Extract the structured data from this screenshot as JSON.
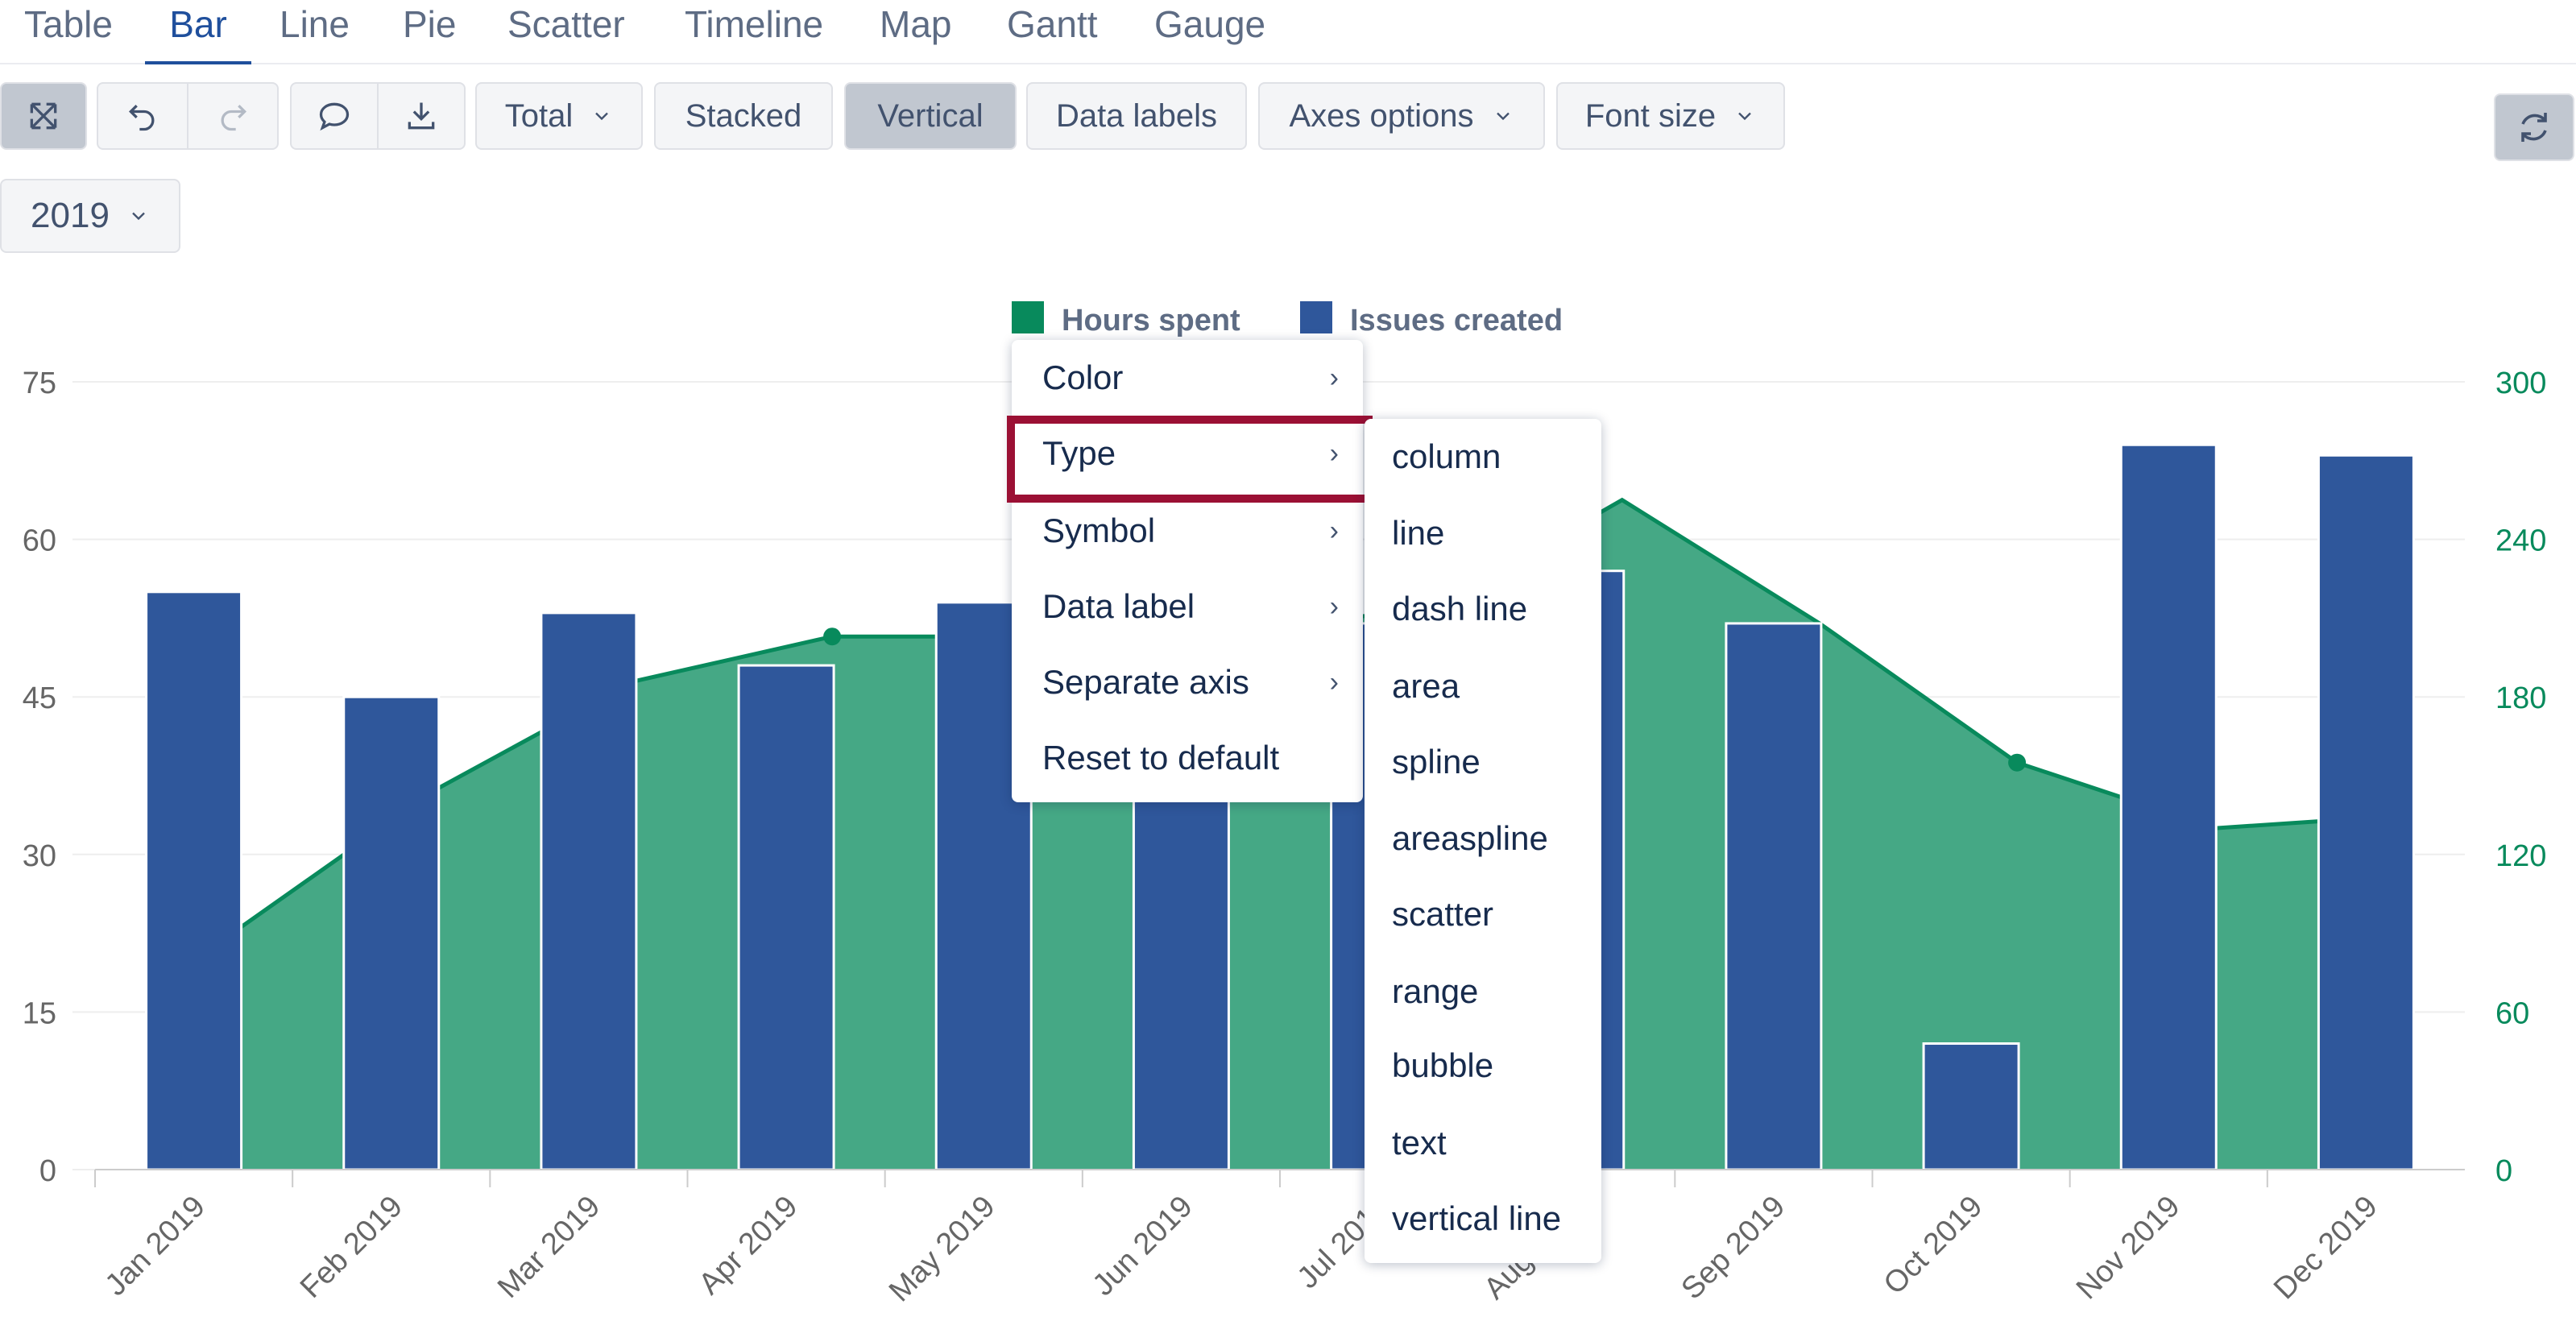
{
  "tabs": [
    "Table",
    "Bar",
    "Line",
    "Pie",
    "Scatter",
    "Timeline",
    "Map",
    "Gantt",
    "Gauge"
  ],
  "active_tab": "Bar",
  "toolbar": {
    "total": "Total",
    "stacked": "Stacked",
    "vertical": "Vertical",
    "data_labels": "Data labels",
    "axes_options": "Axes options",
    "font_size": "Font size",
    "year": "2019"
  },
  "icons": [
    "fullscreen-icon",
    "undo-icon",
    "redo-icon",
    "comment-icon",
    "download-icon",
    "refresh-icon",
    "chevron-down-icon"
  ],
  "colors": {
    "hours": "#088a5c",
    "hours_fill": "#45a885",
    "issues": "#2f579b",
    "highlight": "#9b1034"
  },
  "chart_data": {
    "type": "bar",
    "categories": [
      "Jan 2019",
      "Feb 2019",
      "Mar 2019",
      "Apr 2019",
      "May 2019",
      "Jun 2019",
      "Jul 2019",
      "Aug 2019",
      "Sep 2019",
      "Oct 2019",
      "Nov 2019",
      "Dec 2019"
    ],
    "series": [
      {
        "name": "Issues created",
        "type": "column",
        "axis": "left",
        "color": "#2f579b",
        "values": [
          55,
          45,
          53,
          48,
          54,
          46,
          52,
          57,
          52,
          12,
          69,
          68
        ]
      },
      {
        "name": "Hours spent",
        "type": "area",
        "axis": "right",
        "color": "#088a5c",
        "values": [
          92,
          145,
          186,
          203,
          203,
          208,
          212,
          255,
          208,
          155,
          130,
          135
        ]
      }
    ],
    "left_ticks": [
      "0",
      "15",
      "30",
      "45",
      "60",
      "75"
    ],
    "right_ticks": [
      "0",
      "60",
      "120",
      "180",
      "240",
      "300"
    ],
    "ylim_left": [
      0,
      75
    ],
    "ylim_right": [
      0,
      300
    ],
    "legend": [
      "Hours spent",
      "Issues created"
    ],
    "legend_position": "top-center",
    "grid": true
  },
  "context_menu": {
    "items": [
      {
        "label": "Color",
        "submenu": true
      },
      {
        "label": "Type",
        "submenu": true
      },
      {
        "label": "Symbol",
        "submenu": true
      },
      {
        "label": "Data label",
        "submenu": true
      },
      {
        "label": "Separate axis",
        "submenu": true
      },
      {
        "label": "Reset to default",
        "submenu": false
      }
    ],
    "highlighted": "Type"
  },
  "type_submenu": [
    "column",
    "line",
    "dash line",
    "area",
    "spline",
    "areaspline",
    "scatter",
    "range",
    "bubble",
    "text",
    "vertical line"
  ]
}
